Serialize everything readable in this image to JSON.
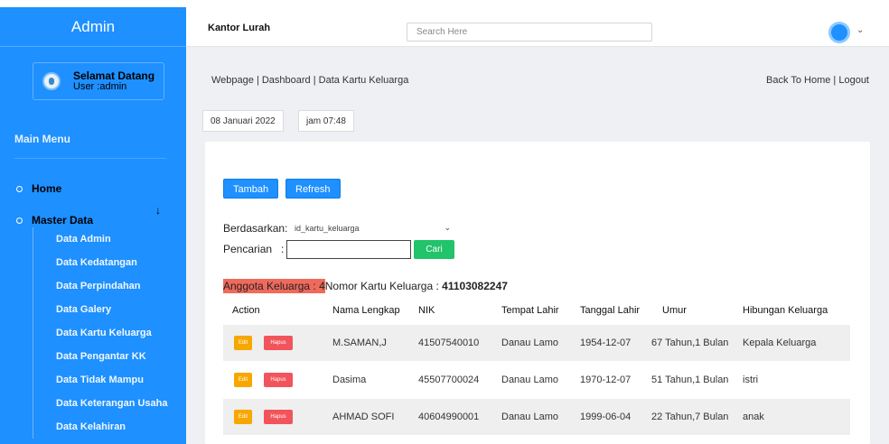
{
  "sidebar": {
    "brand": "Admin",
    "welcome_title": "Selamat Datang",
    "welcome_user": "User :admin",
    "menu_head": "Main Menu",
    "home": "Home",
    "master_data": "Master Data",
    "sub_items": [
      "Data Admin",
      "Data Kedatangan",
      "Data Perpindahan",
      "Data Galery",
      "Data Kartu Keluarga",
      "Data Pengantar KK",
      "Data Tidak Mampu",
      "Data Keterangan Usaha",
      "Data Kelahiran"
    ]
  },
  "topbar": {
    "title": "Kantor Lurah",
    "search_placeholder": "Search Here",
    "chevron": "⌄"
  },
  "header": {
    "breadcrumb": "Webpage  |  Dashboard  |  Data Kartu Keluarga",
    "back_links": "Back To Home  |  Logout",
    "date": "08 Januari 2022",
    "time": "jam 07:48"
  },
  "toolbar": {
    "tambah": "Tambah",
    "refresh": "Refresh",
    "filter_label": "Berdasarkan:",
    "filter_value": "id_kartu_keluarga",
    "search_label": "Pencarian",
    "search_colon": ":",
    "cari": "Cari"
  },
  "summary": {
    "anggota": "Anggota Keluarga : 4",
    "nomor_label": "Nomor Kartu Keluarga : ",
    "nomor_value": "41103082247"
  },
  "table": {
    "columns": [
      "Action",
      "Nama Lengkap",
      "NIK",
      "Tempat Lahir",
      "Tanggal Lahir",
      "Umur",
      "Hibungan Keluarga"
    ],
    "edit_label": "Edit",
    "hapus_label": "Hapus",
    "rows": [
      [
        "M.SAMAN,J",
        "41507540010",
        "Danau Lamo",
        "1954-12-07",
        "67 Tahun,1 Bulan",
        "Kepala Keluarga"
      ],
      [
        "Dasima",
        "45507700024",
        "Danau Lamo",
        "1970-12-07",
        "51 Tahun,1 Bulan",
        "istri"
      ],
      [
        "AHMAD SOFI",
        "40604990001",
        "Danau Lamo",
        "1999-06-04",
        "22 Tahun,7 Bulan",
        "anak"
      ]
    ]
  },
  "colors": {
    "sidebar": "#1e90ff",
    "edit": "#f7a700",
    "hapus": "#f2545b",
    "cari": "#22c36a",
    "highlight": "#f06a5c"
  }
}
